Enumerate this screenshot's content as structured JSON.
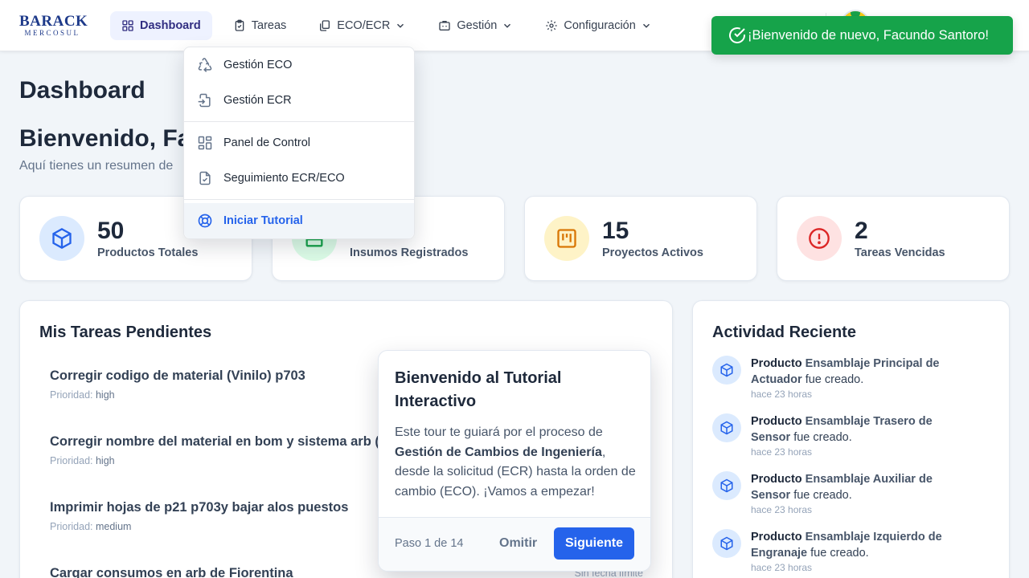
{
  "brand": {
    "line1": "BARACK",
    "line2": "MERCOSUL"
  },
  "nav": {
    "dashboard": "Dashboard",
    "tareas": "Tareas",
    "eco_ecr": "ECO/ECR",
    "gestion": "Gestión",
    "configuracion": "Configuración"
  },
  "toast": {
    "message": "¡Bienvenido de nuevo, Facundo Santoro!"
  },
  "page": {
    "title": "Dashboard",
    "welcome": "Bienvenido, Fa",
    "subtitle": "Aquí tienes un resumen de"
  },
  "stats": [
    {
      "value": "50",
      "label": "Productos Totales"
    },
    {
      "value": "",
      "label": "Insumos Registrados"
    },
    {
      "value": "15",
      "label": "Proyectos Activos"
    },
    {
      "value": "2",
      "label": "Tareas Vencidas"
    }
  ],
  "tasks_panel": {
    "title": "Mis Tareas Pendientes",
    "priority_label": "Prioridad:",
    "tasks": [
      {
        "title": "Corregir codigo de material (Vinilo) p703",
        "priority": "high"
      },
      {
        "title": "Corregir nombre del material en bom y sistema arb (C",
        "priority": "high"
      },
      {
        "title": "Imprimir hojas de p21 p703y bajar alos puestos",
        "priority": "medium"
      },
      {
        "title": "Cargar consumos en arb de Fiorentina",
        "priority": "",
        "due": "Sin fecha límite"
      }
    ]
  },
  "activity_panel": {
    "title": "Actividad Reciente",
    "items": [
      {
        "kind": "Producto",
        "name": "Ensamblaje Principal de Actuador",
        "action": "fue creado.",
        "time": "hace 23 horas"
      },
      {
        "kind": "Producto",
        "name": "Ensamblaje Trasero de Sensor",
        "action": "fue creado.",
        "time": "hace 23 horas"
      },
      {
        "kind": "Producto",
        "name": "Ensamblaje Auxiliar de Sensor",
        "action": "fue creado.",
        "time": "hace 23 horas"
      },
      {
        "kind": "Producto",
        "name": "Ensamblaje Izquierdo de Engranaje",
        "action": "fue creado.",
        "time": "hace 23 horas"
      }
    ]
  },
  "dropdown": {
    "items": [
      {
        "label": "Gestión ECO",
        "icon": "recycle-icon"
      },
      {
        "label": "Gestión ECR",
        "icon": "file-import-icon"
      },
      {
        "label": "Panel de Control",
        "icon": "dashboard-grid-icon"
      },
      {
        "label": "Seguimiento ECR/ECO",
        "icon": "file-check-icon"
      },
      {
        "label": "Iniciar Tutorial",
        "icon": "lifebuoy-icon"
      }
    ]
  },
  "tour": {
    "title": "Bienvenido al Tutorial Interactivo",
    "body_pre": "Este tour te guiará por el proceso de ",
    "body_bold": "Gestión de Cambios de Ingeniería",
    "body_post": ", desde la solicitud (ECR) hasta la orden de cambio (ECO). ¡Vamos a empezar!",
    "step": "Paso 1 de 14",
    "skip": "Omitir",
    "next": "Siguiente"
  },
  "colors": {
    "accent": "#2563eb",
    "toast_bg": "#16a34a",
    "nav_active_bg": "#eef2ff",
    "stat_blue": "#dbeafe",
    "stat_green": "#dcfce7",
    "stat_amber": "#fef3c7",
    "stat_red": "#fee2e2"
  }
}
